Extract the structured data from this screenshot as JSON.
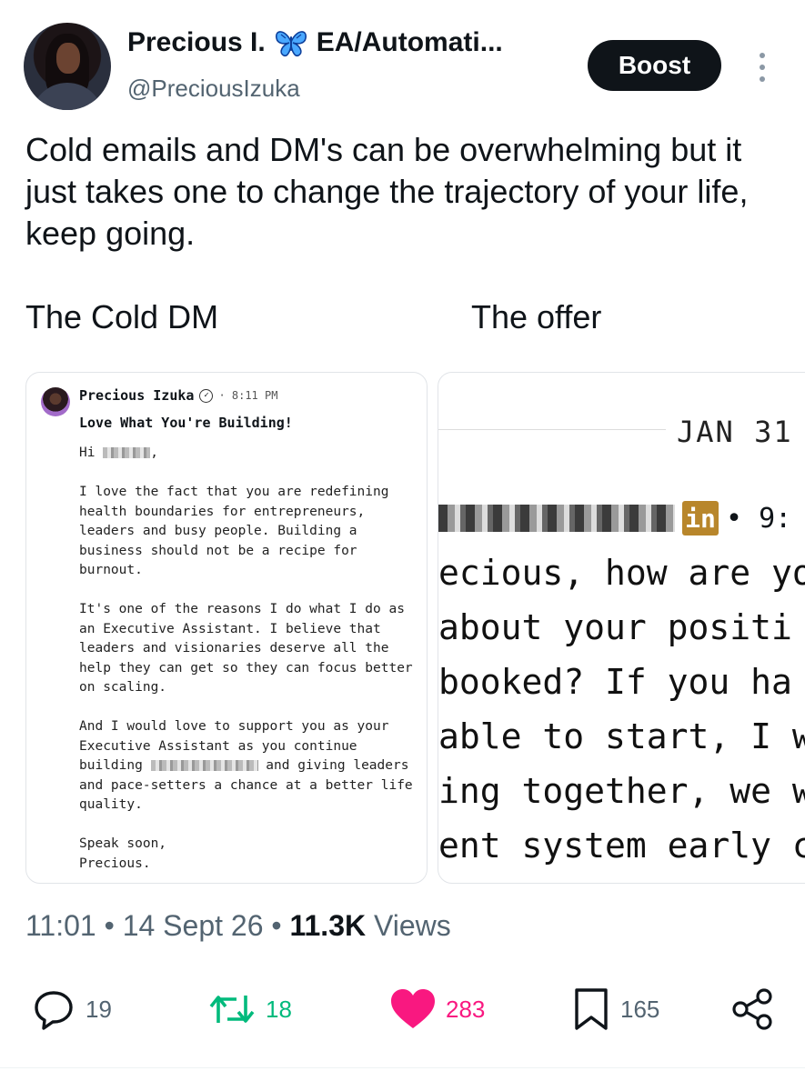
{
  "author": {
    "display_name": "Precious I.",
    "display_name_suffix": "EA/Automati...",
    "handle": "@PreciousIzuka"
  },
  "header": {
    "boost_label": "Boost"
  },
  "tweet": {
    "text": "Cold emails and DM's can be overwhelming but it just takes one to change the trajectory of your life, keep going."
  },
  "captions": {
    "left": "The Cold DM",
    "right": "The offer"
  },
  "dm_card": {
    "sender": "Precious Izuka",
    "time": "· 8:11 PM",
    "subject": "Love What You're Building!",
    "greeting": "Hi ",
    "para1": "I love the fact that you are redefining health boundaries for entrepreneurs, leaders and busy people. Building a business should not be a recipe for burnout.",
    "para2": "It's one of the reasons I do what I do as an Executive Assistant. I believe that leaders and visionaries deserve all the help they can get so they can focus better on scaling.",
    "para3_a": "And I would love to support you as your Executive Assistant as you continue building ",
    "para3_b": " and giving leaders and pace-setters a chance at a better life quality.",
    "signoff": "Speak soon,",
    "signature": "Precious."
  },
  "offer_card": {
    "date": "JAN 31",
    "badge": "in",
    "time_partial": "• 9:",
    "lines": [
      "ecious, how are yo",
      " about your positi",
      "booked? If you ha",
      "able to start, I wo",
      "ing together, we w",
      "ent system early c"
    ]
  },
  "meta": {
    "time": "11:01",
    "sep1": " • ",
    "date": "14 Sept 26",
    "sep2": " • ",
    "views_count": "11.3K",
    "views_label": " Views"
  },
  "actions": {
    "replies": "19",
    "reposts": "18",
    "likes": "283",
    "bookmarks": "165"
  },
  "colors": {
    "boost_bg": "#0f1419",
    "repost_green": "#00ba7c",
    "like_pink": "#f91880",
    "muted": "#536471",
    "butterfly_blue": "#1d6ff2",
    "linkedin_badge": "#b8862b"
  },
  "icons": [
    "butterfly-icon",
    "more-options-icon",
    "verified-icon",
    "linkedin-icon",
    "reply-icon",
    "repost-icon",
    "like-icon",
    "bookmark-icon",
    "share-icon"
  ]
}
